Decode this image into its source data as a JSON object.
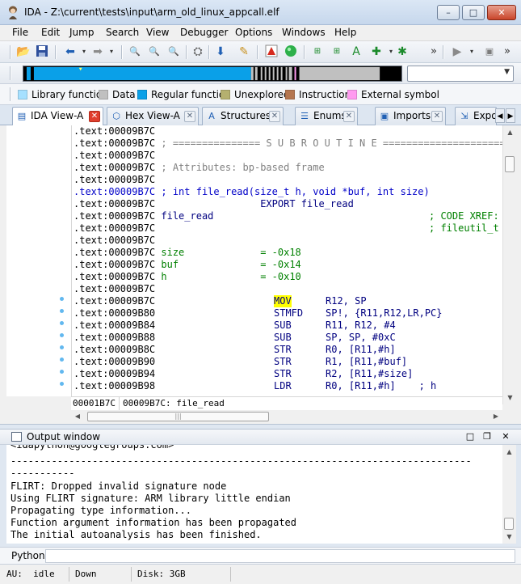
{
  "window": {
    "title": "IDA - Z:\\current\\tests\\input\\arm_old_linux_appcall.elf",
    "minimize": "–",
    "maximize": "□",
    "close": "✕"
  },
  "menu": [
    "File",
    "Edit",
    "Jump",
    "Search",
    "View",
    "Debugger",
    "Options",
    "Windows",
    "Help"
  ],
  "toolbar": {
    "overflow_label": "»"
  },
  "legend": [
    {
      "label": "Library function",
      "color": "#a6e0ff"
    },
    {
      "label": "Data",
      "color": "#c0c0c0"
    },
    {
      "label": "Regular function",
      "color": "#0aa0e8"
    },
    {
      "label": "Unexplored",
      "color": "#b5b06f"
    },
    {
      "label": "Instruction",
      "color": "#b5764f"
    },
    {
      "label": "External symbol",
      "color": "#ff9bf0"
    }
  ],
  "tabs": [
    {
      "label": "IDA View-A",
      "icon": "ida-view-icon",
      "active": true
    },
    {
      "label": "Hex View-A",
      "icon": "hex-view-icon",
      "active": false
    },
    {
      "label": "Structures",
      "icon": "structures-icon",
      "active": false
    },
    {
      "label": "Enums",
      "icon": "enums-icon",
      "active": false
    },
    {
      "label": "Imports",
      "icon": "imports-icon",
      "active": false
    },
    {
      "label": "Expo",
      "icon": "exports-icon",
      "active": false
    }
  ],
  "listing": {
    "lines": [
      {
        "addr": ".text:00009B7C",
        "content": ""
      },
      {
        "addr": ".text:00009B7C",
        "content": " ; =============== S U B R O U T I N E ======================================="
      },
      {
        "addr": ".text:00009B7C",
        "content": ""
      },
      {
        "addr": ".text:00009B7C",
        "content": " ; Attributes: bp-based frame"
      },
      {
        "addr": ".text:00009B7C",
        "content": ""
      },
      {
        "addr": ".text:00009B7C",
        "content": " ; int file_read(size_t h, void *buf, int size)"
      },
      {
        "addr": ".text:00009B7C",
        "content": "                  EXPORT file_read"
      },
      {
        "addr": ".text:00009B7C",
        "content": " file_read",
        "xref": "; CODE XREF:"
      },
      {
        "addr": ".text:00009B7C",
        "content": "",
        "xref": "; fileutil_t"
      },
      {
        "addr": ".text:00009B7C",
        "content": ""
      },
      {
        "addr": ".text:00009B7C",
        "content": " size             = -0x18"
      },
      {
        "addr": ".text:00009B7C",
        "content": " buf              = -0x14"
      },
      {
        "addr": ".text:00009B7C",
        "content": " h                = -0x10"
      },
      {
        "addr": ".text:00009B7C",
        "content": ""
      },
      {
        "addr": ".text:00009B7C",
        "mnem": "MOV",
        "ops": "R12, SP"
      },
      {
        "addr": ".text:00009B80",
        "mnem": "STMFD",
        "ops": "SP!, {R11,R12,LR,PC}"
      },
      {
        "addr": ".text:00009B84",
        "mnem": "SUB",
        "ops": "R11, R12, #4"
      },
      {
        "addr": ".text:00009B88",
        "mnem": "SUB",
        "ops": "SP, SP, #0xC"
      },
      {
        "addr": ".text:00009B8C",
        "mnem": "STR",
        "ops": "R0, [R11,#h]"
      },
      {
        "addr": ".text:00009B90",
        "mnem": "STR",
        "ops": "R1, [R11,#buf]"
      },
      {
        "addr": ".text:00009B94",
        "mnem": "STR",
        "ops": "R2, [R11,#size]"
      },
      {
        "addr": ".text:00009B98",
        "mnem": "LDR",
        "ops": "R0, [R11,#h]    ; h"
      }
    ],
    "status_offset": "00001B7C",
    "status_location": "00009B7C: file_read"
  },
  "output": {
    "title": "Output window",
    "lines": [
      "<idapython@googlegroups.com>",
      "-------------------------------------------------------------------------------",
      "-----------",
      "FLIRT: Dropped invalid signature node",
      "Using FLIRT signature: ARM library little endian",
      "Propagating type information...",
      "Function argument information has been propagated",
      "The initial autoanalysis has been finished."
    ]
  },
  "python": {
    "label": "Python",
    "value": ""
  },
  "statusbar": {
    "au": "AU:  idle",
    "direction": "Down",
    "disk": "Disk: 3GB"
  }
}
